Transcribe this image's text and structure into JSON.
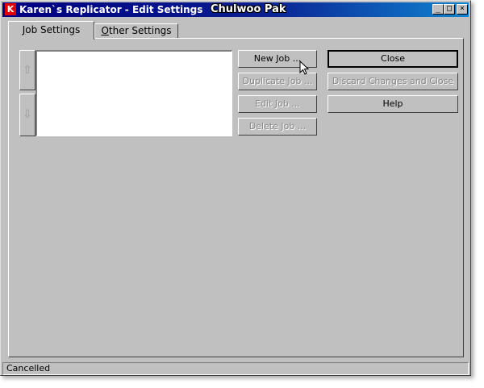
{
  "window": {
    "title": "Karen`s Replicator - Edit Settings",
    "overlay_text": "Chulwoo Pak",
    "app_icon_letter": "K",
    "controls": {
      "minimize": "_",
      "maximize": "□",
      "close": "×"
    }
  },
  "tabs": [
    {
      "label_first": "J",
      "label_rest": "ob Settings",
      "active": true
    },
    {
      "label_first": "O",
      "label_rest": "ther Settings",
      "active": false
    }
  ],
  "job_buttons": {
    "new_job": "New Job ...",
    "duplicate_job": "Duplicate Job ...",
    "edit_job": "Edit Job ...",
    "delete_job": "Delete Job ..."
  },
  "action_buttons": {
    "close": "Close",
    "discard": "Discard Changes and Close",
    "help": "Help"
  },
  "reorder": {
    "up_icon": "⇧",
    "down_icon": "⇩"
  },
  "status": {
    "text": "Cancelled"
  }
}
